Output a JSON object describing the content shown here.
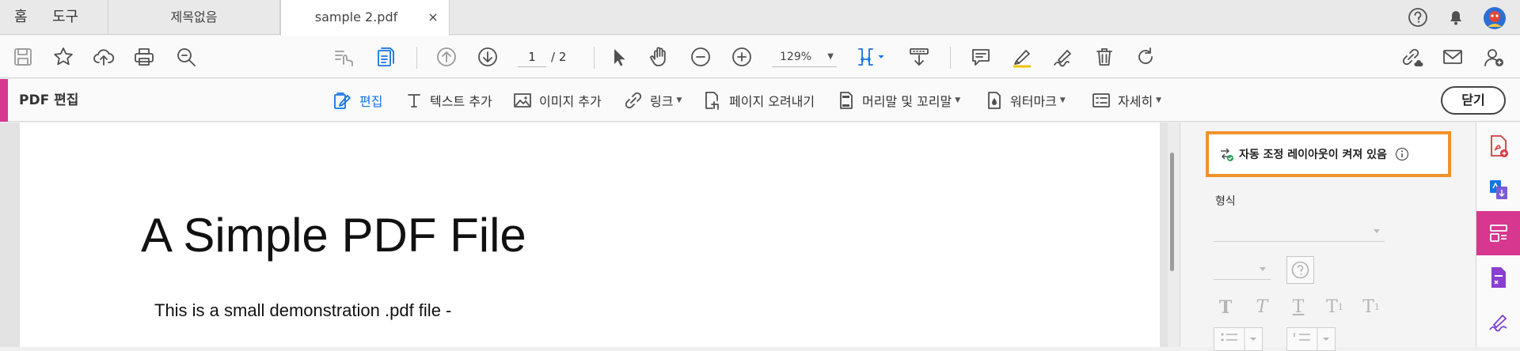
{
  "tabbar": {
    "home": "홈",
    "tools": "도구",
    "tabs": [
      {
        "label": "제목없음"
      },
      {
        "label": "sample 2.pdf",
        "close": "×"
      }
    ]
  },
  "toolbar": {
    "page_current": "1",
    "page_total": "/  2",
    "zoom": "129%"
  },
  "editbar": {
    "title": "PDF 편집",
    "tools": {
      "edit": "편집",
      "add_text": "텍스트 추가",
      "add_image": "이미지 추가",
      "link": "링크",
      "crop": "페이지 오려내기",
      "header_footer": "머리말 및 꼬리말",
      "watermark": "워터마크",
      "more": "자세히"
    },
    "close": "닫기"
  },
  "document": {
    "title": "A Simple PDF File",
    "text": "This is a small demonstration .pdf file -"
  },
  "panel": {
    "autolayout": "자동 조정 레이아웃이 켜져 있음",
    "format_label": "형식"
  },
  "colors": {
    "accent": "#d83790",
    "highlight": "#f0932b",
    "selected": "#1473e6"
  }
}
